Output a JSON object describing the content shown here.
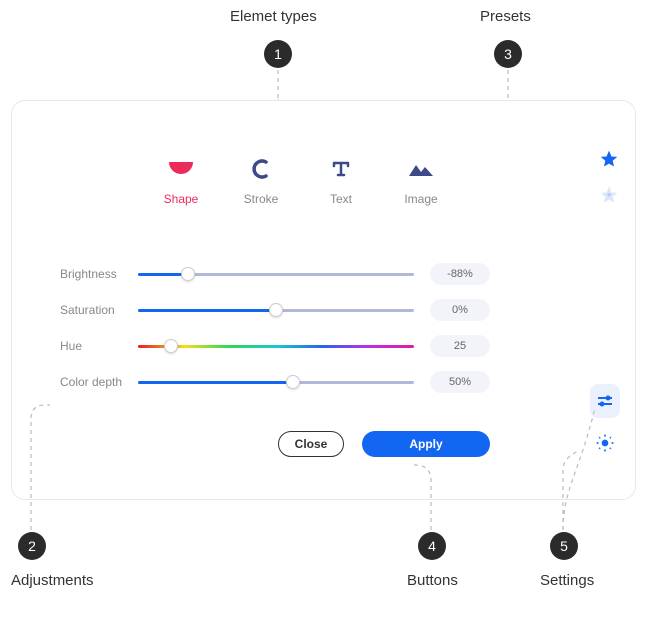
{
  "annotations": {
    "a1": {
      "num": "1",
      "label": "Elemet types"
    },
    "a2": {
      "num": "2",
      "label": "Adjustments"
    },
    "a3": {
      "num": "3",
      "label": "Presets"
    },
    "a4": {
      "num": "4",
      "label": "Buttons"
    },
    "a5": {
      "num": "5",
      "label": "Settings"
    }
  },
  "elementTypes": {
    "shape": "Shape",
    "stroke": "Stroke",
    "text": "Text",
    "image": "Image"
  },
  "sliders": {
    "brightness": {
      "label": "Brightness",
      "value": "-88%",
      "pct": 18
    },
    "saturation": {
      "label": "Saturation",
      "value": "0%",
      "pct": 50
    },
    "hue": {
      "label": "Hue",
      "value": "25",
      "pct": 12
    },
    "colorDepth": {
      "label": "Color depth",
      "value": "50%",
      "pct": 56
    }
  },
  "buttons": {
    "close": "Close",
    "apply": "Apply"
  }
}
